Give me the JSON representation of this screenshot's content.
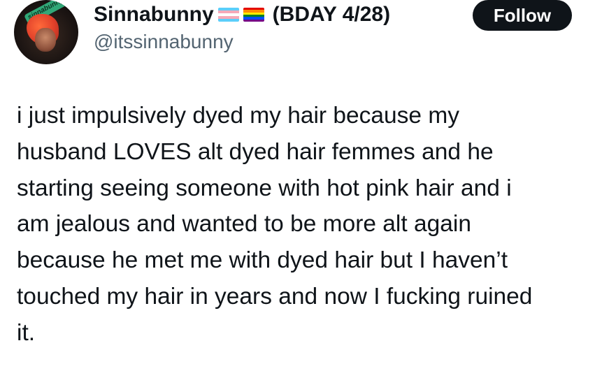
{
  "author": {
    "display_name": "Sinnabunny",
    "name_suffix": "(BDAY 4/28)",
    "handle": "@itssinnabunny",
    "avatar_text": "sinnabunny",
    "flags": [
      "transgender-flag",
      "rainbow-pride-flag"
    ]
  },
  "follow_button": {
    "label": "Follow"
  },
  "tweet": {
    "lines": [
      "i just impulsively dyed my hair because my",
      "husband LOVES alt dyed hair femmes and he",
      "starting seeing someone with hot pink hair and i",
      "am jealous and wanted to be more alt again",
      "because he met me with dyed hair but I haven’t",
      "touched my hair in years and now I fucking ruined",
      "it."
    ]
  },
  "colors": {
    "text_primary": "#0f1419",
    "text_secondary": "#536471",
    "button_bg": "#0f1419",
    "button_text": "#ffffff"
  }
}
